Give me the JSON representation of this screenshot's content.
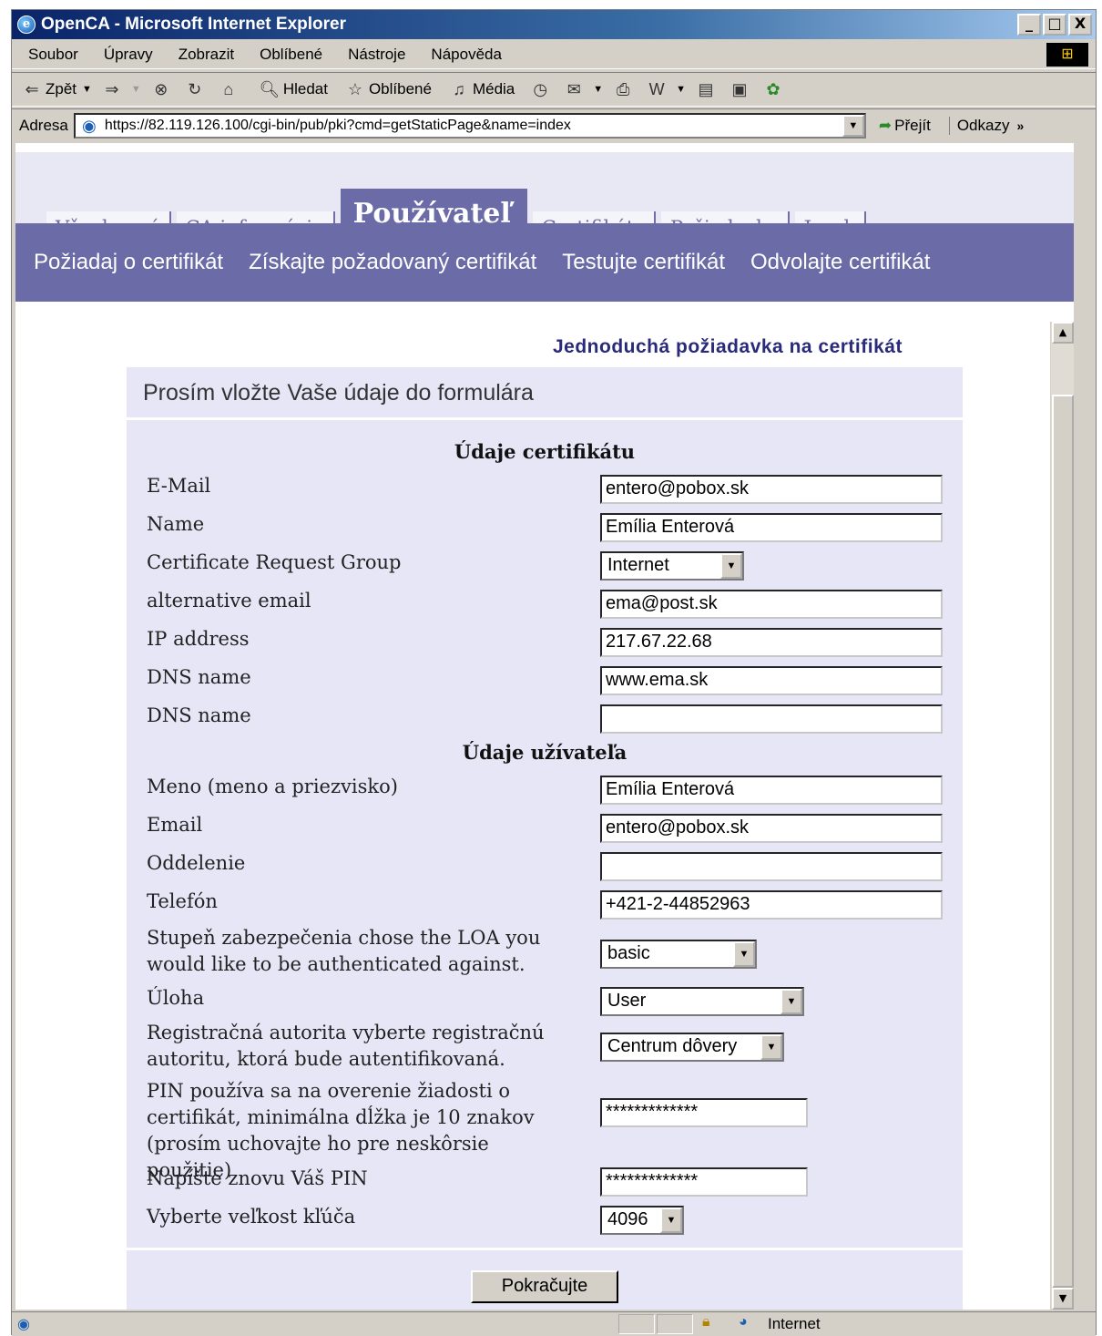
{
  "window": {
    "title": "OpenCA - Microsoft Internet Explorer",
    "min_label": "_",
    "max_label": "□",
    "close_label": "X"
  },
  "menu": [
    "Soubor",
    "Úpravy",
    "Zobrazit",
    "Oblíbené",
    "Nástroje",
    "Nápověda"
  ],
  "toolbar": {
    "back": "Zpět",
    "search": "Hledat",
    "favorites": "Oblíbené",
    "media": "Média"
  },
  "address": {
    "label": "Adresa",
    "url": "https://82.119.126.100/cgi-bin/pub/pki?cmd=getStaticPage&name=index",
    "go": "Přejít",
    "links": "Odkazy",
    "more": "»"
  },
  "tabs": [
    "Všeobecné",
    "CA informácie",
    "Používateľ",
    "Certifikáty",
    "Požiadavky",
    "Jazyk"
  ],
  "subnav": [
    "Požiadaj o certifikát",
    "Získajte požadovaný certifikát",
    "Testujte certifikát",
    "Odvolajte certifikát"
  ],
  "form": {
    "title": "Jednoduchá požiadavka na certifikát",
    "intro": "Prosím vložte Vaše údaje do formulára",
    "section_cert": "Údaje certifikátu",
    "section_user": "Údaje užívateľa",
    "rows": [
      {
        "label": "E-Mail",
        "value": "entero@pobox.sk"
      },
      {
        "label": "Name",
        "value": "Emília Enterová"
      },
      {
        "label": "Certificate Request Group",
        "value": "Internet"
      },
      {
        "label": "alternative email",
        "value": "ema@post.sk"
      },
      {
        "label": "IP address",
        "value": "217.67.22.68"
      },
      {
        "label": "DNS name",
        "value": "www.ema.sk"
      },
      {
        "label": "DNS name",
        "value": ""
      },
      {
        "label": "Meno (meno a priezvisko)",
        "value": "Emília Enterová"
      },
      {
        "label": "Email",
        "value": "entero@pobox.sk"
      },
      {
        "label": "Oddelenie",
        "value": ""
      },
      {
        "label": "Telefón",
        "value": "+421-2-44852963"
      },
      {
        "label_1": "Stupeň zabezpečenia chose the LOA you",
        "label_2": "would like to be authenticated against.",
        "value": "basic"
      },
      {
        "label": "Úloha",
        "value": "User"
      },
      {
        "label_1": "Registračná autorita vyberte registračnú",
        "label_2": "autoritu, ktorá bude autentifikovaná.",
        "value": "Centrum dôvery"
      },
      {
        "label_1": "PIN používa sa na overenie žiadosti o",
        "label_2": "certifikát, minimálna dĺžka je 10 znakov",
        "label_3": "(prosím uchovajte ho pre neskôrsie použitie)",
        "value": "*************"
      },
      {
        "label": "Napíšte znovu Váš PIN",
        "value": "*************"
      },
      {
        "label": "Vyberte veľkost kľúča",
        "value": "4096"
      }
    ],
    "submit": "Pokračujte"
  },
  "status": {
    "zone": "Internet"
  }
}
